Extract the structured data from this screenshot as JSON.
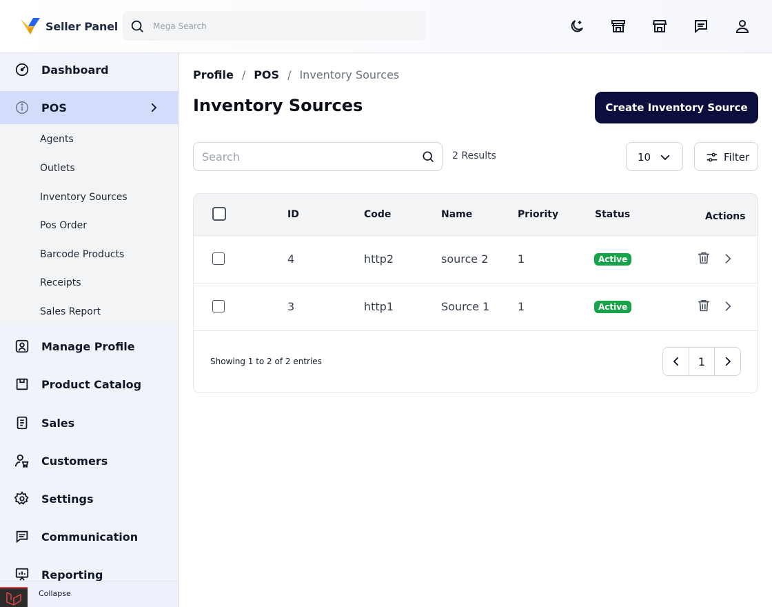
{
  "header": {
    "brand": "Seller Panel",
    "search_placeholder": "Mega Search"
  },
  "icons": {
    "theme": "moon-icon",
    "store": "storefront-icon",
    "shop": "shop-icon",
    "messages": "chat-icon",
    "account": "user-icon"
  },
  "colors": {
    "primary": "#0c0f3d",
    "active_nav": "#d4dcfb",
    "status_active": "#16a34a"
  },
  "sidebar": {
    "items": [
      {
        "label": "Dashboard"
      },
      {
        "label": "POS"
      },
      {
        "label": "Manage Profile"
      },
      {
        "label": "Product Catalog"
      },
      {
        "label": "Sales"
      },
      {
        "label": "Customers"
      },
      {
        "label": "Settings"
      },
      {
        "label": "Communication"
      },
      {
        "label": "Reporting"
      }
    ],
    "pos_submenu": [
      {
        "label": "Agents"
      },
      {
        "label": "Outlets"
      },
      {
        "label": "Inventory Sources"
      },
      {
        "label": "Pos Order"
      },
      {
        "label": "Barcode Products"
      },
      {
        "label": "Receipts"
      },
      {
        "label": "Sales Report"
      }
    ],
    "collapse_label": "Collapse"
  },
  "main": {
    "breadcrumb": [
      "Profile",
      "POS",
      "Inventory Sources"
    ],
    "title": "Inventory Sources",
    "create_button": "Create Inventory Source",
    "search_placeholder": "Search",
    "results_text": "2 Results",
    "per_page": "10",
    "filter_label": "Filter",
    "table": {
      "columns": [
        "ID",
        "Code",
        "Name",
        "Priority",
        "Status",
        "Actions"
      ],
      "rows": [
        {
          "id": "4",
          "code": "http2",
          "name": "source 2",
          "priority": "1",
          "status": "Active"
        },
        {
          "id": "3",
          "code": "http1",
          "name": "Source 1",
          "priority": "1",
          "status": "Active"
        }
      ]
    },
    "showing_text": "Showing 1 to 2 of 2 entries",
    "current_page": "1"
  }
}
